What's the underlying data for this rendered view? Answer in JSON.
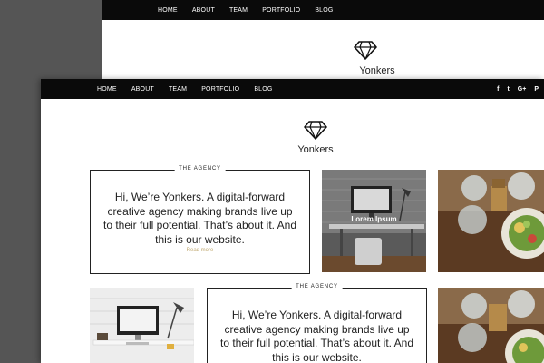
{
  "nav": {
    "items": [
      "HOME",
      "ABOUT",
      "TEAM",
      "PORTFOLIO",
      "BLOG"
    ]
  },
  "social": {
    "icons": [
      "facebook-icon",
      "twitter-icon",
      "google-plus-icon",
      "pinterest-icon"
    ],
    "glyphs": [
      "f",
      "t",
      "G+",
      "P"
    ]
  },
  "brand": {
    "name": "Yonkers",
    "logo": "diamond-icon"
  },
  "agency": {
    "tag": "THE AGENCY",
    "headline": "Hi, We’re Yonkers. A digital-forward creative agency making brands live up to their full potential. That’s about it. And this is our website.",
    "read_more": "Read more"
  },
  "tiles": [
    {
      "caption": "Lorem Ipsum"
    }
  ],
  "colors": {
    "nav_bg": "#0a0a0a",
    "accent": "#c0a870",
    "backdrop": "#555555"
  }
}
